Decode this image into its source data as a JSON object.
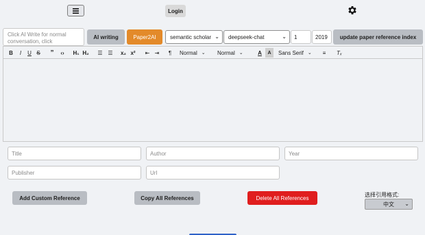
{
  "header": {
    "menu_icon": "hamburger-menu-icon",
    "login_label": "Login",
    "settings_icon": "gear-icon"
  },
  "composer": {
    "prompt_placeholder": "Click AI Write for normal conversation, click",
    "ai_writing_label": "AI writing",
    "paper2ai_label": "Paper2AI",
    "source_select": "semantic scholar",
    "model_select": "deepseek-chat",
    "count_value": "1",
    "year_value": "2019",
    "update_label": "update paper reference index"
  },
  "toolbar": {
    "bold": "B",
    "italic": "I",
    "underline": "U",
    "strike": "S",
    "quote": "”",
    "code": "‹›",
    "h1": "H₁",
    "h2": "H₂",
    "ordered_list": "☰",
    "bullet_list": "☰",
    "subscript": "x₂",
    "superscript": "x²",
    "outdent": "⇤",
    "indent": "⇥",
    "rtl": "¶",
    "size_select": "Normal",
    "header_select": "Normal",
    "font_color": "A",
    "background_color": "A",
    "font_select": "Sans Serif",
    "align": "≡",
    "clean": "Tₓ"
  },
  "reference_form": {
    "title_placeholder": "Title",
    "author_placeholder": "Author",
    "year_placeholder": "Year",
    "publisher_placeholder": "Publisher",
    "url_placeholder": "Url"
  },
  "actions": {
    "add_label": "Add Custom Reference",
    "copy_label": "Copy All References",
    "delete_label": "Delete All References",
    "cite_format_label": "选择引用格式:",
    "cite_format_value": "中文"
  },
  "colors": {
    "accent_orange": "#e38a2a",
    "danger_red": "#e01e1e",
    "button_grey": "#b9bdc3",
    "background": "#f0f2f5"
  }
}
